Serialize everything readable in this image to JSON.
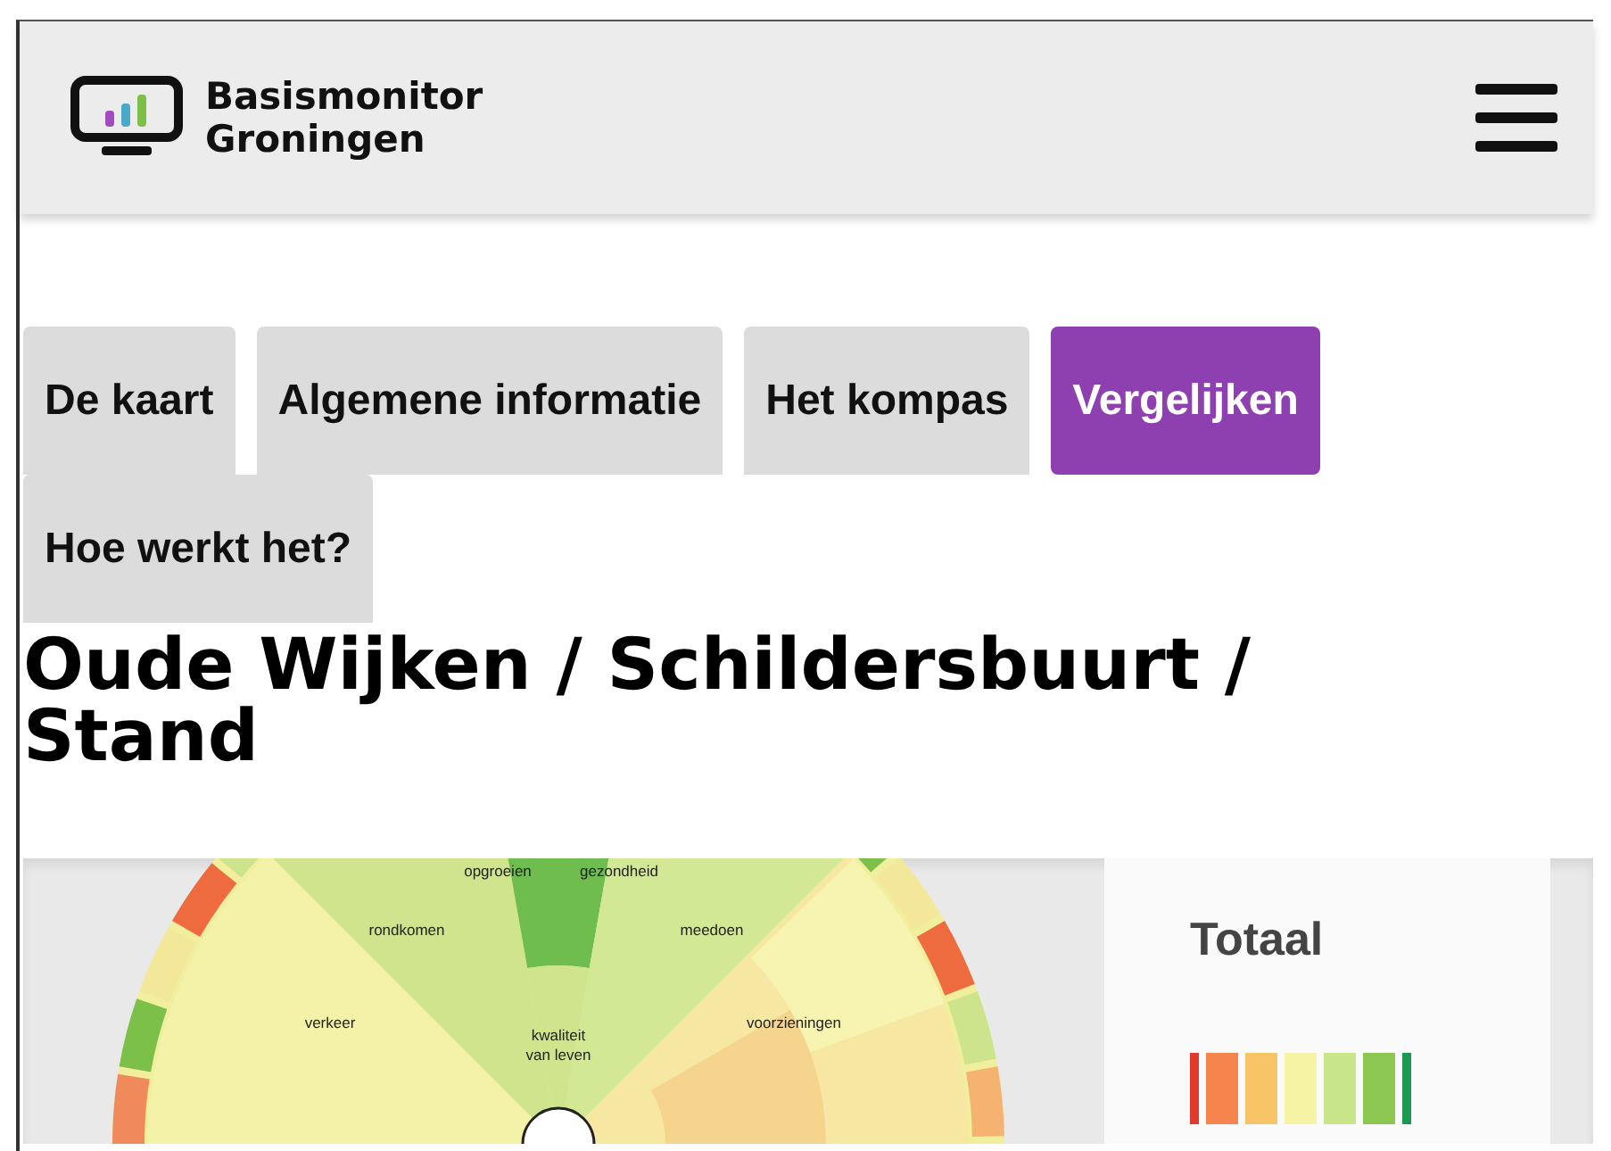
{
  "header": {
    "brand_line_1": "Basismonitor",
    "brand_line_2": "Groningen"
  },
  "tabs": [
    {
      "label": "De kaart",
      "selected": false
    },
    {
      "label": "Algemene informatie",
      "selected": false
    },
    {
      "label": "Het kompas",
      "selected": false
    },
    {
      "label": "Vergelijken",
      "selected": true
    },
    {
      "label": "Hoe werkt het?",
      "selected": false
    }
  ],
  "title_line_1": "Oude Wijken / Schildersbuurt /",
  "title_line_2": "Stand",
  "wheel": {
    "labels": [
      "opgroeien",
      "gezondheid",
      "rondkomen",
      "meedoen",
      "verkeer",
      "kwaliteit van leven",
      "voorzieningen"
    ]
  },
  "summary": {
    "title": "Totaal",
    "legend": [
      {
        "color": "#e03a2c"
      },
      {
        "color": "#f5854d"
      },
      {
        "color": "#f7c468"
      },
      {
        "color": "#f6f3a4"
      },
      {
        "color": "#c8e58a"
      },
      {
        "color": "#8cc751"
      },
      {
        "color": "#1a9a50"
      }
    ]
  }
}
